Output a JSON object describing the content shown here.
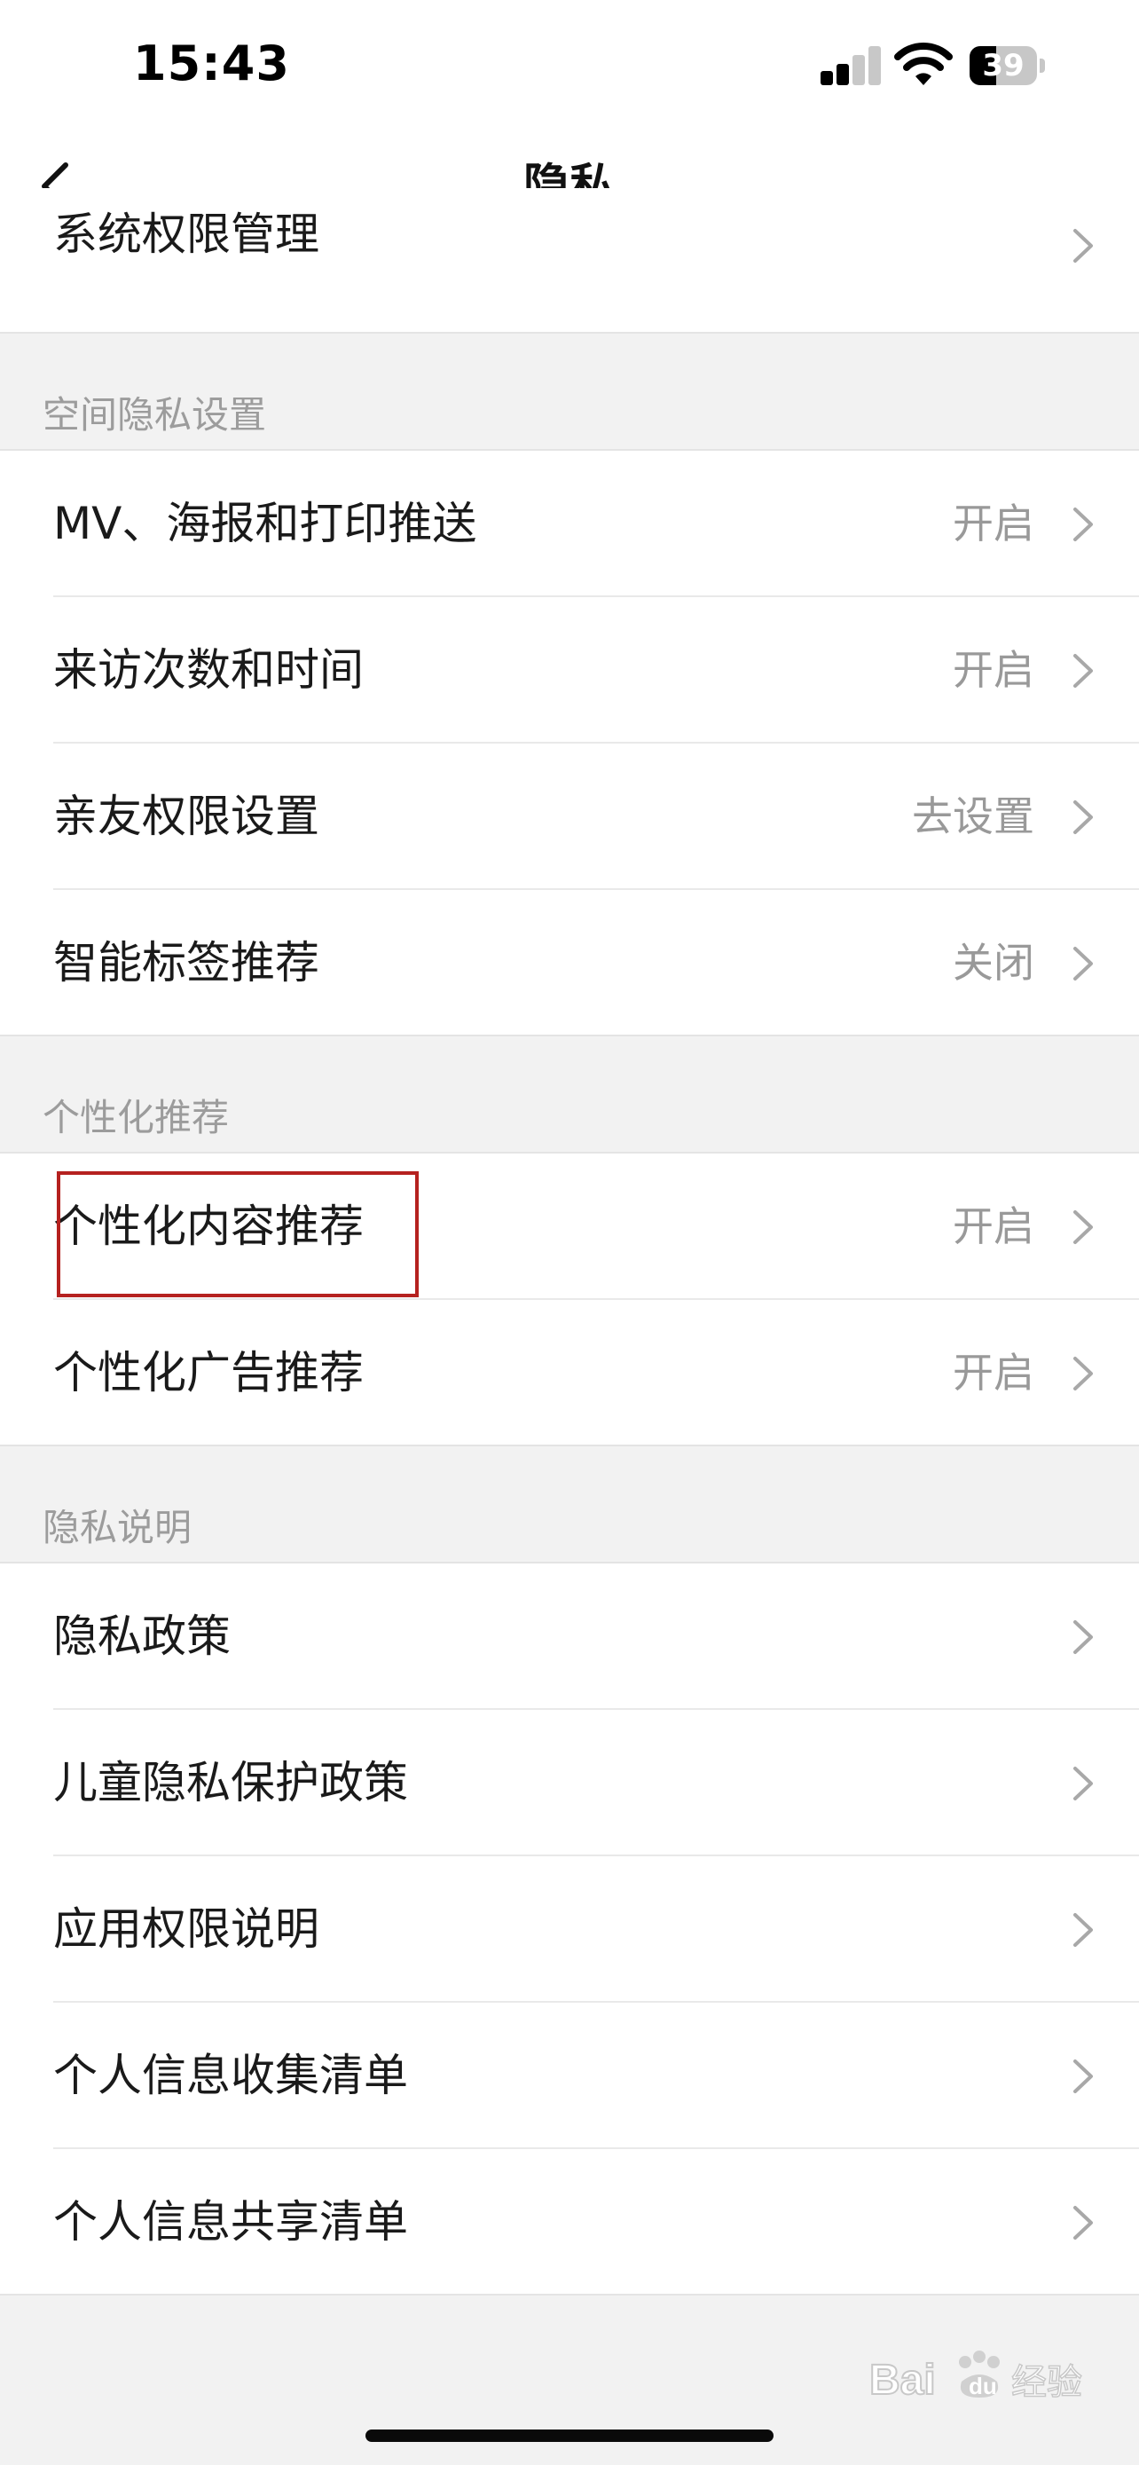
{
  "status_bar": {
    "time": "15:43",
    "battery": "39",
    "battery_level": 0.39
  },
  "nav": {
    "title": "隐私",
    "back_icon": "chevron-left-icon"
  },
  "top_rows": [
    {
      "label": "系统权限管理",
      "value": ""
    }
  ],
  "sections": [
    {
      "title": "空间隐私设置",
      "rows": [
        {
          "label": "MV、海报和打印推送",
          "value": "开启"
        },
        {
          "label": "来访次数和时间",
          "value": "开启"
        },
        {
          "label": "亲友权限设置",
          "value": "去设置"
        },
        {
          "label": "智能标签推荐",
          "value": "关闭"
        }
      ]
    },
    {
      "title": "个性化推荐",
      "rows": [
        {
          "label": "个性化内容推荐",
          "value": "开启"
        },
        {
          "label": "个性化广告推荐",
          "value": "开启"
        }
      ]
    },
    {
      "title": "隐私说明",
      "rows": [
        {
          "label": "隐私政策",
          "value": ""
        },
        {
          "label": "儿童隐私保护政策",
          "value": ""
        },
        {
          "label": "应用权限说明",
          "value": ""
        },
        {
          "label": "个人信息收集清单",
          "value": ""
        },
        {
          "label": "个人信息共享清单",
          "value": ""
        }
      ]
    }
  ],
  "watermark": {
    "text": "Baidu经验"
  },
  "colors": {
    "highlight": "#b5211f",
    "background": "#f2f2f2",
    "value_text": "#999999"
  }
}
